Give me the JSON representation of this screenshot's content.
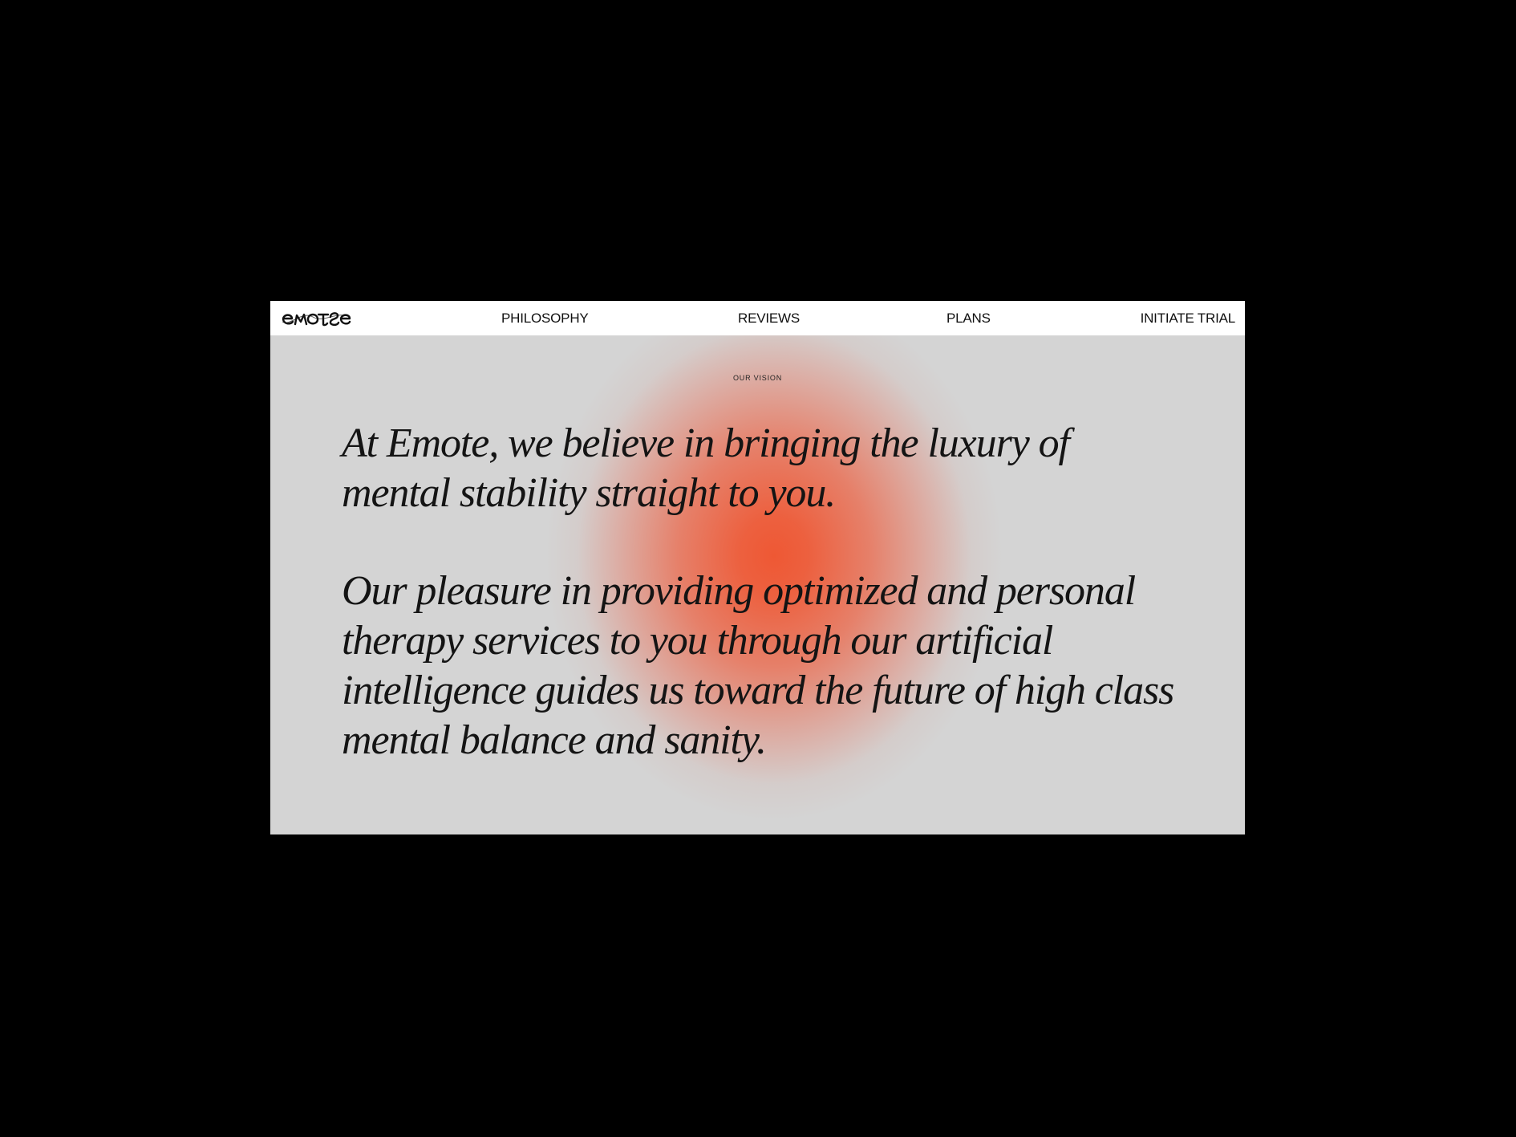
{
  "brand": {
    "logo_text": "emote"
  },
  "nav": {
    "items": [
      {
        "label": "PHILOSOPHY"
      },
      {
        "label": "REVIEWS"
      },
      {
        "label": "PLANS"
      }
    ],
    "cta_label": "INITIATE TRIAL"
  },
  "hero": {
    "eyebrow": "OUR VISION",
    "paragraphs": [
      "At Emote, we believe in bringing the luxury of mental stability straight to you.",
      "Our pleasure in providing optimized and personal therapy services to you through our artificial intelligence guides us toward the future of high class mental balance and sanity."
    ]
  },
  "colors": {
    "page_background": "#000000",
    "nav_background": "#ffffff",
    "hero_background": "#d4d4d4",
    "glow_accent": "#ee5834",
    "text": "#141414"
  }
}
